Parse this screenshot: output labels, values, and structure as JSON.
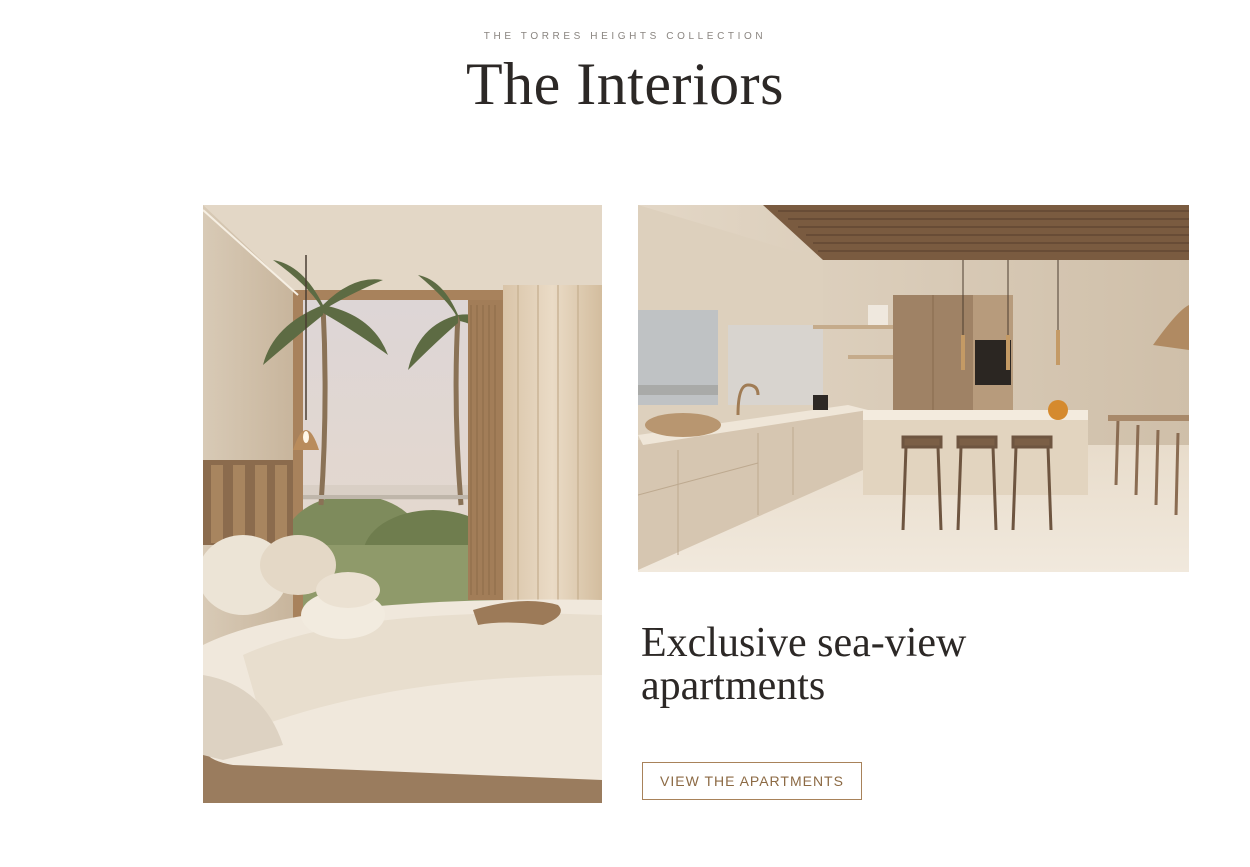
{
  "section": {
    "eyebrow": "THE TORRES HEIGHTS COLLECTION",
    "title": "The Interiors"
  },
  "gallery": {
    "bedroom_image": "bedroom-render",
    "kitchen_image": "kitchen-render"
  },
  "feature": {
    "headline_line1": "Exclusive sea-view",
    "headline_line2": "apartments",
    "cta_label": "VIEW THE APARTMENTS"
  },
  "colors": {
    "text": "#2c2826",
    "muted": "#8a8580",
    "accent": "#a8825a",
    "sand": "#e8dccb"
  }
}
